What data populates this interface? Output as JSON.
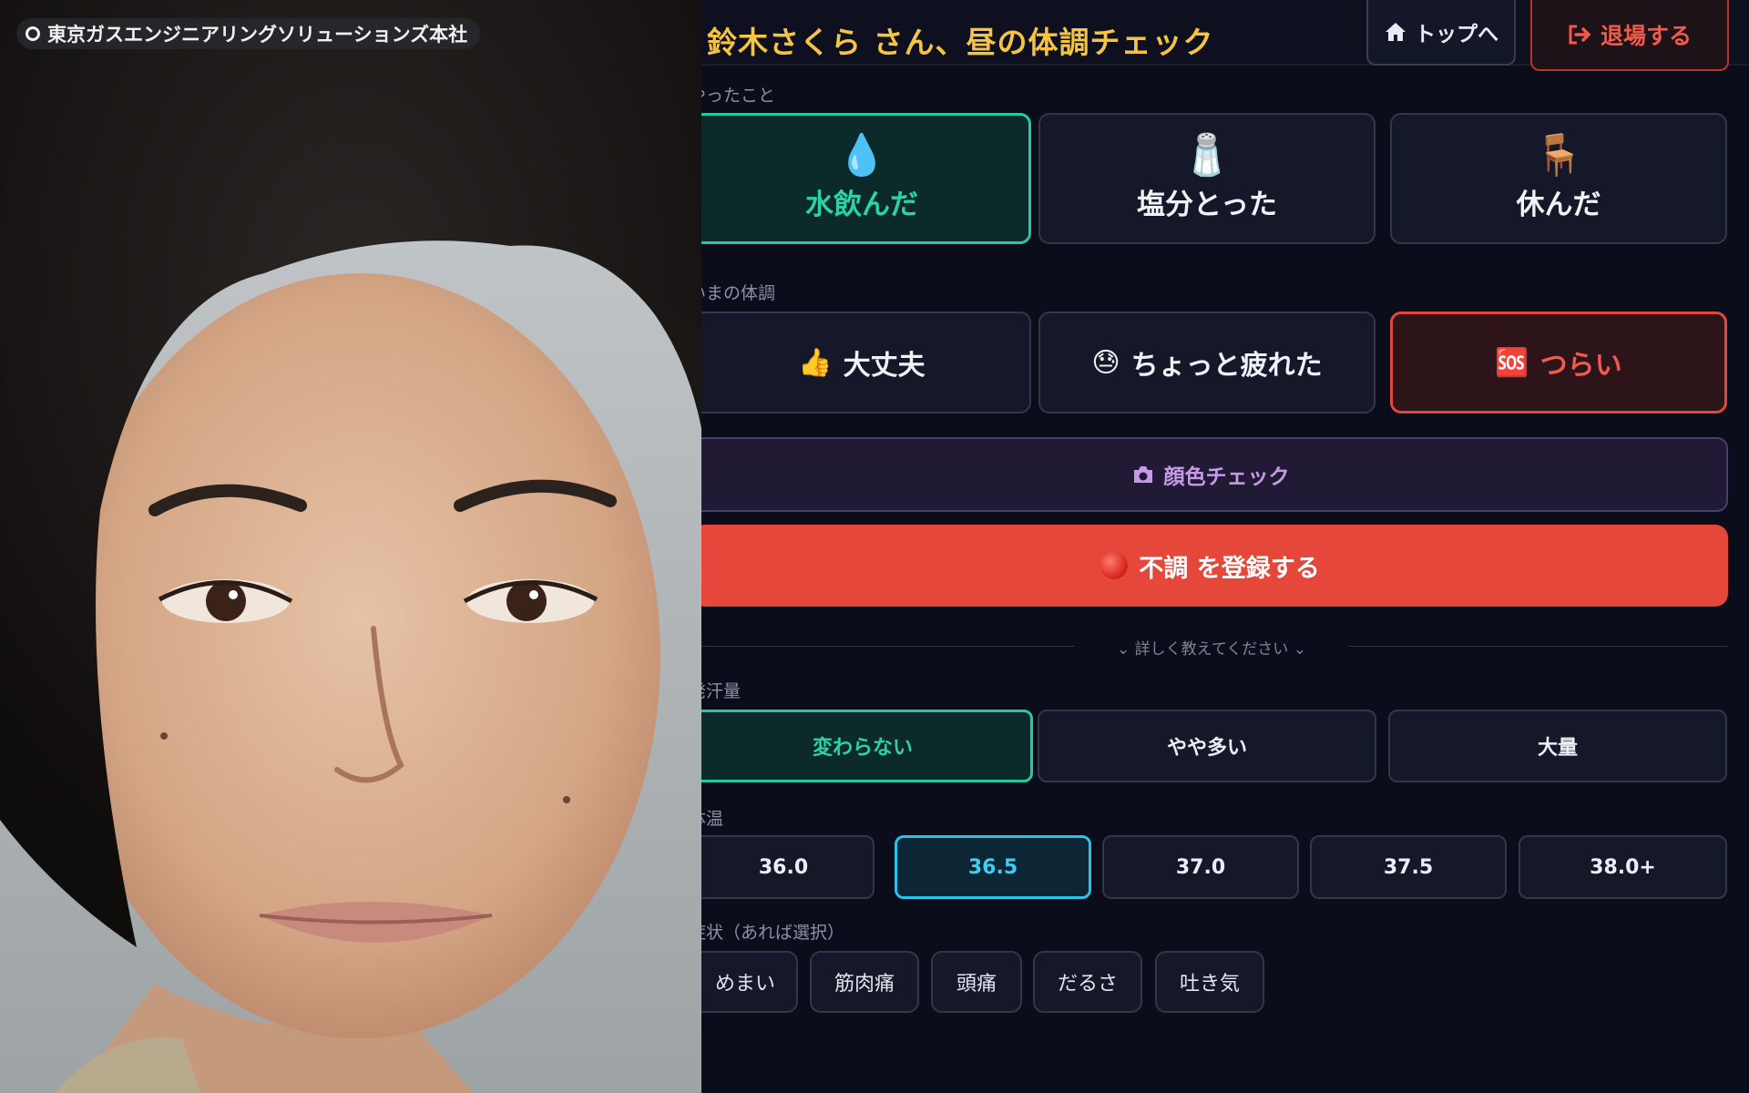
{
  "camera": {
    "location": "東京ガスエンジニアリングソリューションズ本社"
  },
  "header": {
    "title": "鈴木さくら さん、昼の体調チェック",
    "top_button": "トップへ",
    "exit_button": "退場する"
  },
  "actions_section": {
    "label": "やったこと",
    "items": [
      {
        "emoji": "💧",
        "label": "水飲んだ",
        "selected": true
      },
      {
        "emoji": "🧂",
        "label": "塩分とった",
        "selected": false
      },
      {
        "emoji": "🪑",
        "label": "休んだ",
        "selected": false
      }
    ]
  },
  "condition_section": {
    "label": "いまの体調",
    "items": [
      {
        "emoji": "👍",
        "label": "大丈夫",
        "selected": false
      },
      {
        "emoji": "😓",
        "label": "ちょっと疲れた",
        "selected": false
      },
      {
        "emoji": "🆘",
        "label": "つらい",
        "selected": true
      }
    ]
  },
  "face_check_button": "顔色チェック",
  "register_button": "不調 を登録する",
  "details_toggle": "詳しく教えてください",
  "sweat_section": {
    "label": "発汗量",
    "options": [
      "変わらない",
      "やや多い",
      "大量"
    ],
    "selected": "変わらない"
  },
  "temperature_section": {
    "label": "体温",
    "options": [
      "36.0",
      "36.5",
      "37.0",
      "37.5",
      "38.0+"
    ],
    "selected": "36.5"
  },
  "symptoms_section": {
    "label": "症状（あれば選択）",
    "options": [
      "めまい",
      "筋肉痛",
      "頭痛",
      "だるさ",
      "吐き気"
    ]
  },
  "colors": {
    "title": "#f5c542",
    "accent_green": "#24c9a0",
    "accent_red": "#e5483a",
    "accent_blue": "#2cc1e8",
    "accent_purple": "#c79ae6",
    "background": "#0b0d1a"
  }
}
